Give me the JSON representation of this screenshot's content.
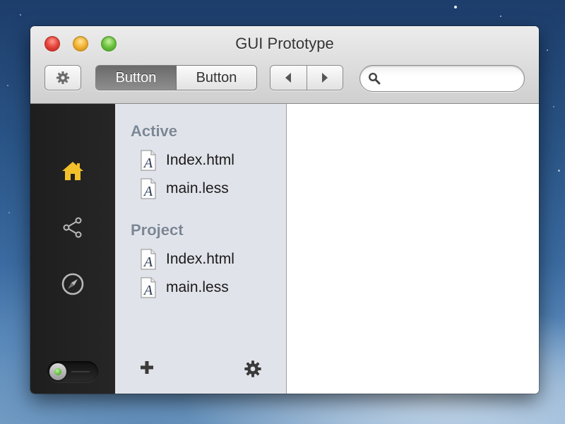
{
  "window": {
    "title": "GUI Prototype"
  },
  "toolbar": {
    "settings_icon": "gear-icon",
    "segmented": [
      {
        "label": "Button",
        "selected": true
      },
      {
        "label": "Button",
        "selected": false
      }
    ],
    "nav": {
      "back_icon": "triangle-left-icon",
      "forward_icon": "triangle-right-icon"
    },
    "search": {
      "icon": "magnifier-icon",
      "value": "",
      "placeholder": ""
    }
  },
  "left_bar": {
    "items": [
      {
        "icon": "home-icon",
        "active": true
      },
      {
        "icon": "share-icon",
        "active": false
      },
      {
        "icon": "compass-icon",
        "active": false
      }
    ],
    "toggle": {
      "state": "on"
    }
  },
  "sidebar": {
    "sections": [
      {
        "title": "Active",
        "items": [
          {
            "label": "Index.html",
            "icon": "text-file-icon"
          },
          {
            "label": "main.less",
            "icon": "text-file-icon"
          }
        ]
      },
      {
        "title": "Project",
        "items": [
          {
            "label": "Index.html",
            "icon": "text-file-icon"
          },
          {
            "label": "main.less",
            "icon": "text-file-icon"
          }
        ]
      }
    ],
    "footer": {
      "add_icon": "plus-icon",
      "settings_icon": "gear-icon"
    }
  },
  "colors": {
    "active_icon": "#f2c02a",
    "section_title": "#7b8795",
    "sidebar_bg": "#e1e3ea",
    "left_bar_bg": "#222222"
  }
}
